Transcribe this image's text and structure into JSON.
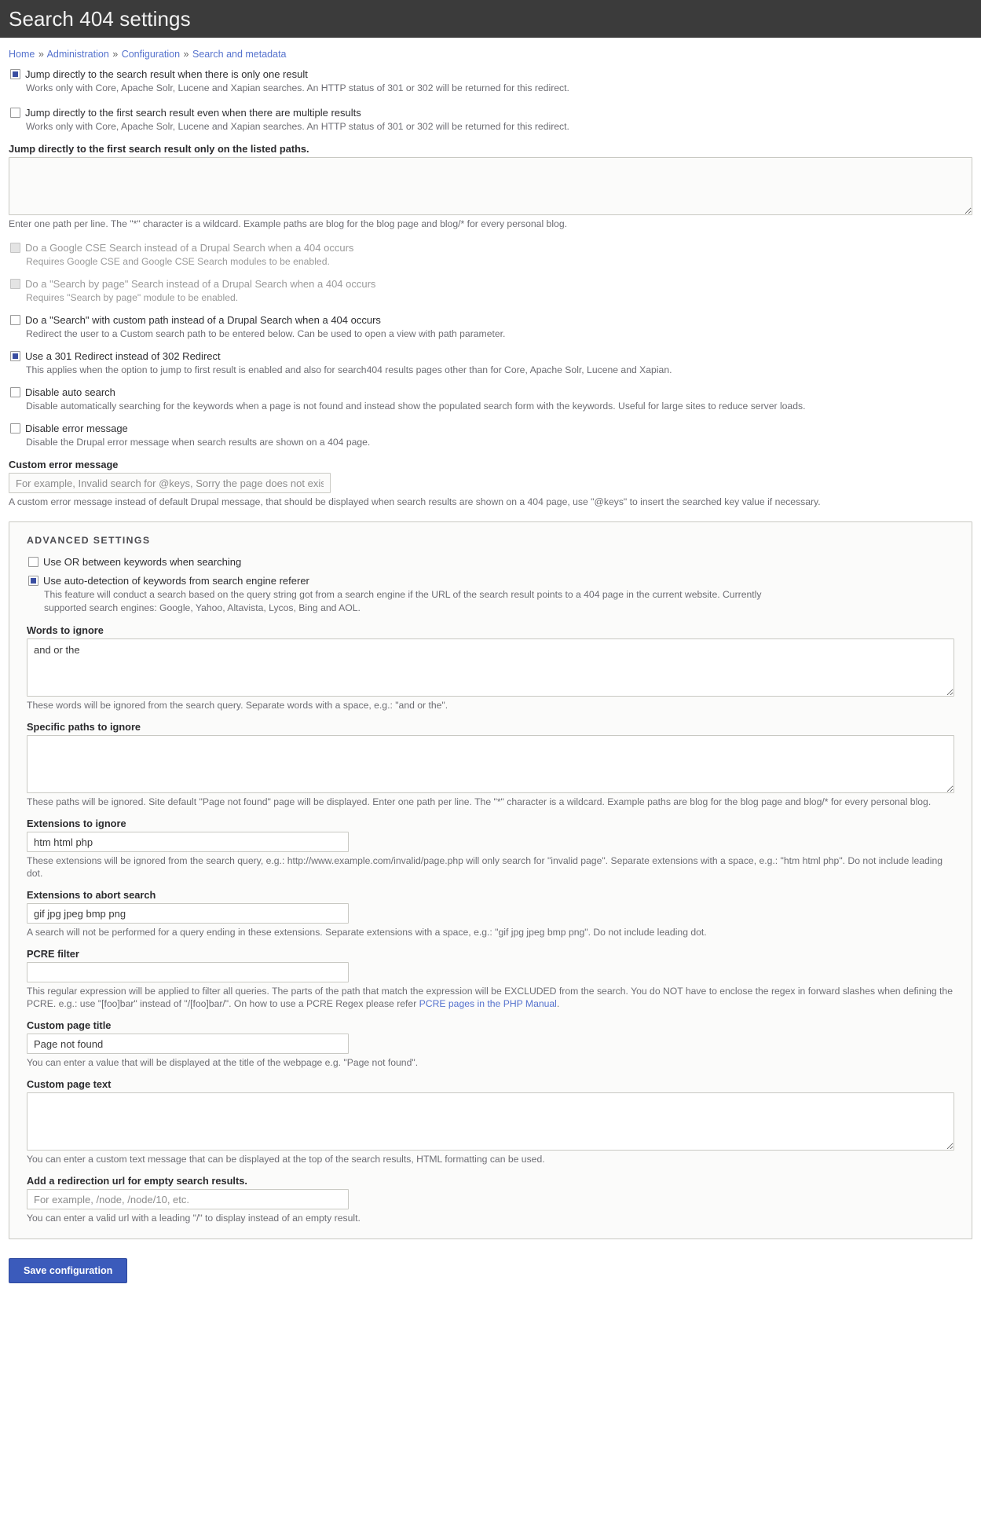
{
  "header": {
    "title": "Search 404 settings"
  },
  "breadcrumb": {
    "separator": "»",
    "items": [
      {
        "label": "Home"
      },
      {
        "label": "Administration"
      },
      {
        "label": "Configuration"
      },
      {
        "label": "Search and metadata"
      }
    ]
  },
  "colors": {
    "header_bg": "#3b3b3b",
    "link": "#5572cd",
    "checkbox_accent": "#3a4ea1",
    "button_primary": "#3b5bbb"
  },
  "main": {
    "checkboxes": [
      {
        "label": "Jump directly to the search result when there is only one result",
        "description": "Works only with Core, Apache Solr, Lucene and Xapian searches. An HTTP status of 301 or 302 will be returned for this redirect.",
        "checked": true,
        "disabled": false
      },
      {
        "label": "Jump directly to the first search result even when there are multiple results",
        "description": "Works only with Core, Apache Solr, Lucene and Xapian searches. An HTTP status of 301 or 302 will be returned for this redirect.",
        "checked": false,
        "disabled": false
      }
    ],
    "jump_paths": {
      "label": "Jump directly to the first search result only on the listed paths.",
      "value": "",
      "placeholder": "",
      "description": "Enter one path per line. The \"*\" character is a wildcard. Example paths are blog for the blog page and blog/* for every personal blog."
    },
    "checkboxes2": [
      {
        "label": "Do a Google CSE Search instead of a Drupal Search when a 404 occurs",
        "description": "Requires Google CSE and Google CSE Search modules to be enabled.",
        "checked": false,
        "disabled": true
      },
      {
        "label": "Do a \"Search by page\" Search instead of a Drupal Search when a 404 occurs",
        "description": "Requires \"Search by page\" module to be enabled.",
        "checked": false,
        "disabled": true
      },
      {
        "label": "Do a \"Search\" with custom path instead of a Drupal Search when a 404 occurs",
        "description": "Redirect the user to a Custom search path to be entered below. Can be used to open a view with path parameter.",
        "checked": false,
        "disabled": false
      },
      {
        "label": "Use a 301 Redirect instead of 302 Redirect",
        "description": "This applies when the option to jump to first result is enabled and also for search404 results pages other than for Core, Apache Solr, Lucene and Xapian.",
        "checked": true,
        "disabled": false
      },
      {
        "label": "Disable auto search",
        "description": "Disable automatically searching for the keywords when a page is not found and instead show the populated search form with the keywords. Useful for large sites to reduce server loads.",
        "checked": false,
        "disabled": false
      },
      {
        "label": "Disable error message",
        "description": "Disable the Drupal error message when search results are shown on a 404 page.",
        "checked": false,
        "disabled": false
      }
    ],
    "custom_error": {
      "label": "Custom error message",
      "value": "",
      "placeholder": "For example, Invalid search for @keys, Sorry the page does not exist, etc.",
      "description": "A custom error message instead of default Drupal message, that should be displayed when search results are shown on a 404 page, use \"@keys\" to insert the searched key value if necessary."
    }
  },
  "advanced": {
    "title": "ADVANCED SETTINGS",
    "checkboxes": [
      {
        "label": "Use OR between keywords when searching",
        "description": "",
        "checked": false,
        "disabled": false
      },
      {
        "label": "Use auto-detection of keywords from search engine referer",
        "description": "This feature will conduct a search based on the query string got from a search engine if the URL of the search result points to a 404 page in the current website. Currently supported search engines: Google, Yahoo, Altavista, Lycos, Bing and AOL.",
        "checked": true,
        "disabled": false
      }
    ],
    "words_to_ignore": {
      "label": "Words to ignore",
      "value": "and or the",
      "placeholder": "",
      "description": "These words will be ignored from the search query. Separate words with a space, e.g.: \"and or the\"."
    },
    "paths_to_ignore": {
      "label": "Specific paths to ignore",
      "value": "",
      "placeholder": "",
      "description": "These paths will be ignored. Site default \"Page not found\" page will be displayed. Enter one path per line. The \"*\" character is a wildcard. Example paths are blog for the blog page and blog/* for every personal blog."
    },
    "extensions_to_ignore": {
      "label": "Extensions to ignore",
      "value": "htm html php",
      "placeholder": "",
      "description": "These extensions will be ignored from the search query, e.g.: http://www.example.com/invalid/page.php will only search for \"invalid page\". Separate extensions with a space, e.g.: \"htm html php\". Do not include leading dot."
    },
    "extensions_to_abort": {
      "label": "Extensions to abort search",
      "value": "gif jpg jpeg bmp png",
      "placeholder": "",
      "description": "A search will not be performed for a query ending in these extensions. Separate extensions with a space, e.g.: \"gif jpg jpeg bmp png\". Do not include leading dot."
    },
    "pcre_filter": {
      "label": "PCRE filter",
      "value": "",
      "placeholder": "",
      "description_before": "This regular expression will be applied to filter all queries. The parts of the path that match the expression will be EXCLUDED from the search. You do NOT have to enclose the regex in forward slashes when defining the PCRE. e.g.: use \"[foo]bar\" instead of \"/[foo]bar/\". On how to use a PCRE Regex please refer ",
      "link_text": "PCRE pages in the PHP Manual",
      "description_after": "."
    },
    "custom_page_title": {
      "label": "Custom page title",
      "value": "Page not found",
      "placeholder": "",
      "description": "You can enter a value that will be displayed at the title of the webpage e.g. \"Page not found\"."
    },
    "custom_page_text": {
      "label": "Custom page text",
      "value": "",
      "placeholder": "",
      "description": "You can enter a custom text message that can be displayed at the top of the search results, HTML formatting can be used."
    },
    "redirect_empty": {
      "label": "Add a redirection url for empty search results.",
      "value": "",
      "placeholder": "For example, /node, /node/10, etc.",
      "description": "You can enter a valid url with a leading \"/\" to display instead of an empty result."
    }
  },
  "actions": {
    "save_label": "Save configuration"
  }
}
